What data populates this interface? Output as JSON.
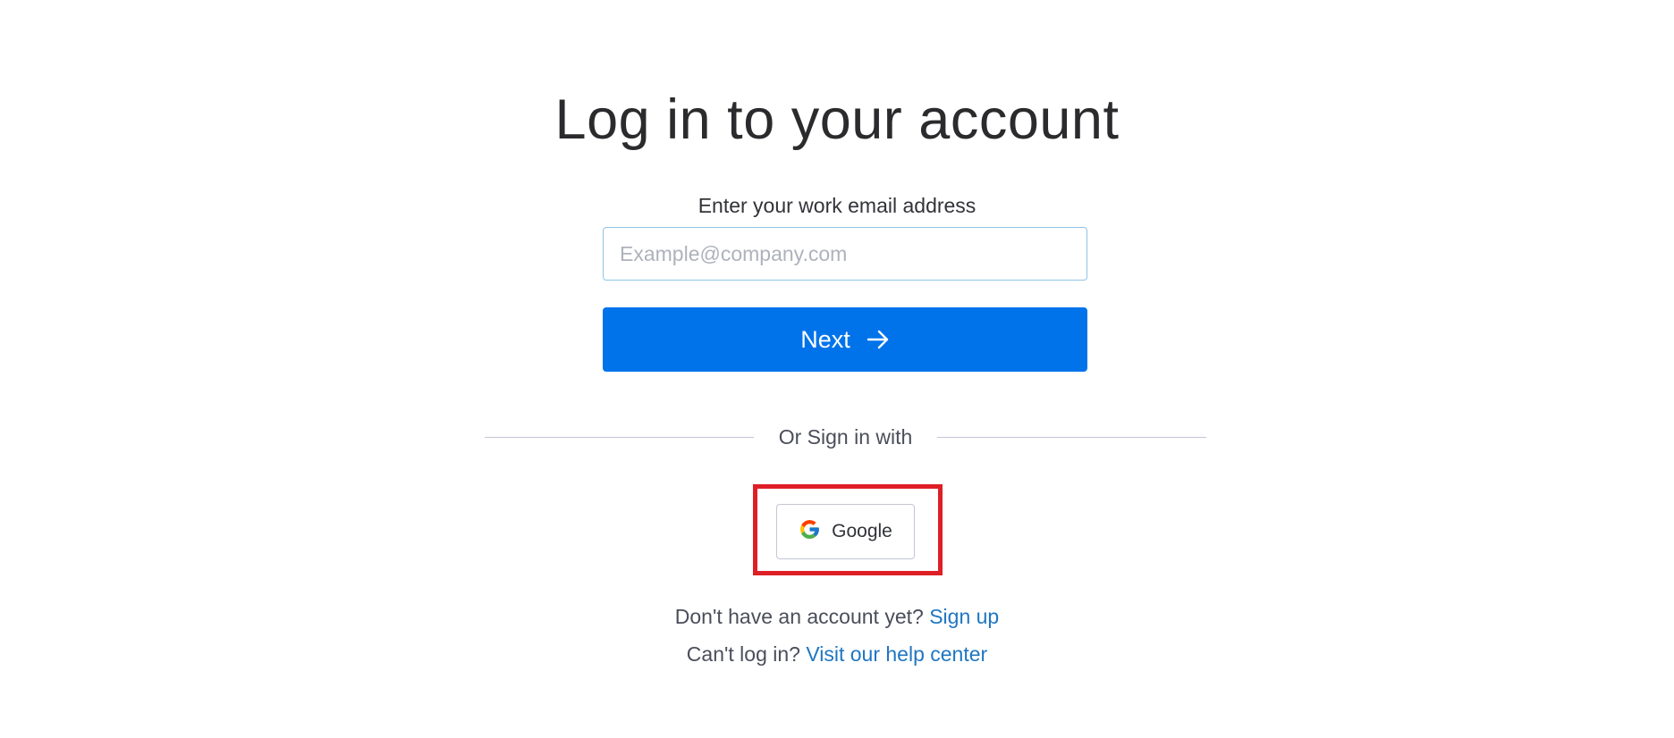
{
  "login": {
    "title": "Log in to your account",
    "email_label": "Enter your work email address",
    "email_placeholder": "Example@company.com",
    "email_value": "",
    "next_label": "Next",
    "divider_text": "Or Sign in with",
    "google_label": "Google",
    "signup_prompt": "Don't have an account yet?",
    "signup_link": "Sign up",
    "help_prompt": "Can't log in?",
    "help_link": "Visit our help center"
  },
  "icons": {
    "next": "arrow-right-icon",
    "google": "google-logo-icon"
  },
  "colors": {
    "primary_button": "#0073ea",
    "link": "#1f76c2",
    "highlight": "#de1f26",
    "input_border": "#8ec3e6"
  }
}
